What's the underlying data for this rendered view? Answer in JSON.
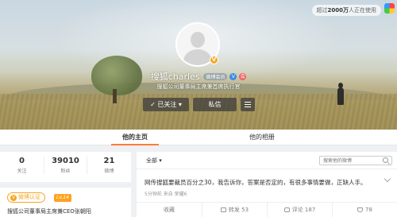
{
  "banner": {
    "top_bar_text_pre": "超过",
    "top_bar_count": "2000万",
    "top_bar_text_post": "人正在使用"
  },
  "profile": {
    "name": "搜狐charles",
    "level": "微博会员",
    "description": "搜狐公司董事局主席兼首席执行官",
    "follow_label": "已关注",
    "message_label": "私信",
    "verified_mark": "V",
    "blue_v_mark": "V",
    "member_mark": "会"
  },
  "tabs": [
    "他的主页",
    "他的相册"
  ],
  "counts": [
    {
      "value": "0",
      "label": "关注"
    },
    {
      "value": "39010",
      "label": "粉丝"
    },
    {
      "value": "21",
      "label": "微博"
    }
  ],
  "verification": {
    "badge_label": "微博认证",
    "badge_icon": "V",
    "level_badge": "Lv.14",
    "text": "搜狐公司董事局主席兼CEO张朝阳"
  },
  "feed": {
    "filter_label": "全部",
    "search_placeholder": "搜索他的微博",
    "post_text": "网传搜狐要裁员百分之30，我告诉你，答案是否定的，有很多事情要做，正缺人手。",
    "post_meta": "5分钟前 来自 荣耀6",
    "actions": {
      "favorite": "收藏",
      "forward": "转发 53",
      "comment": "评论 187",
      "like": "78"
    }
  }
}
